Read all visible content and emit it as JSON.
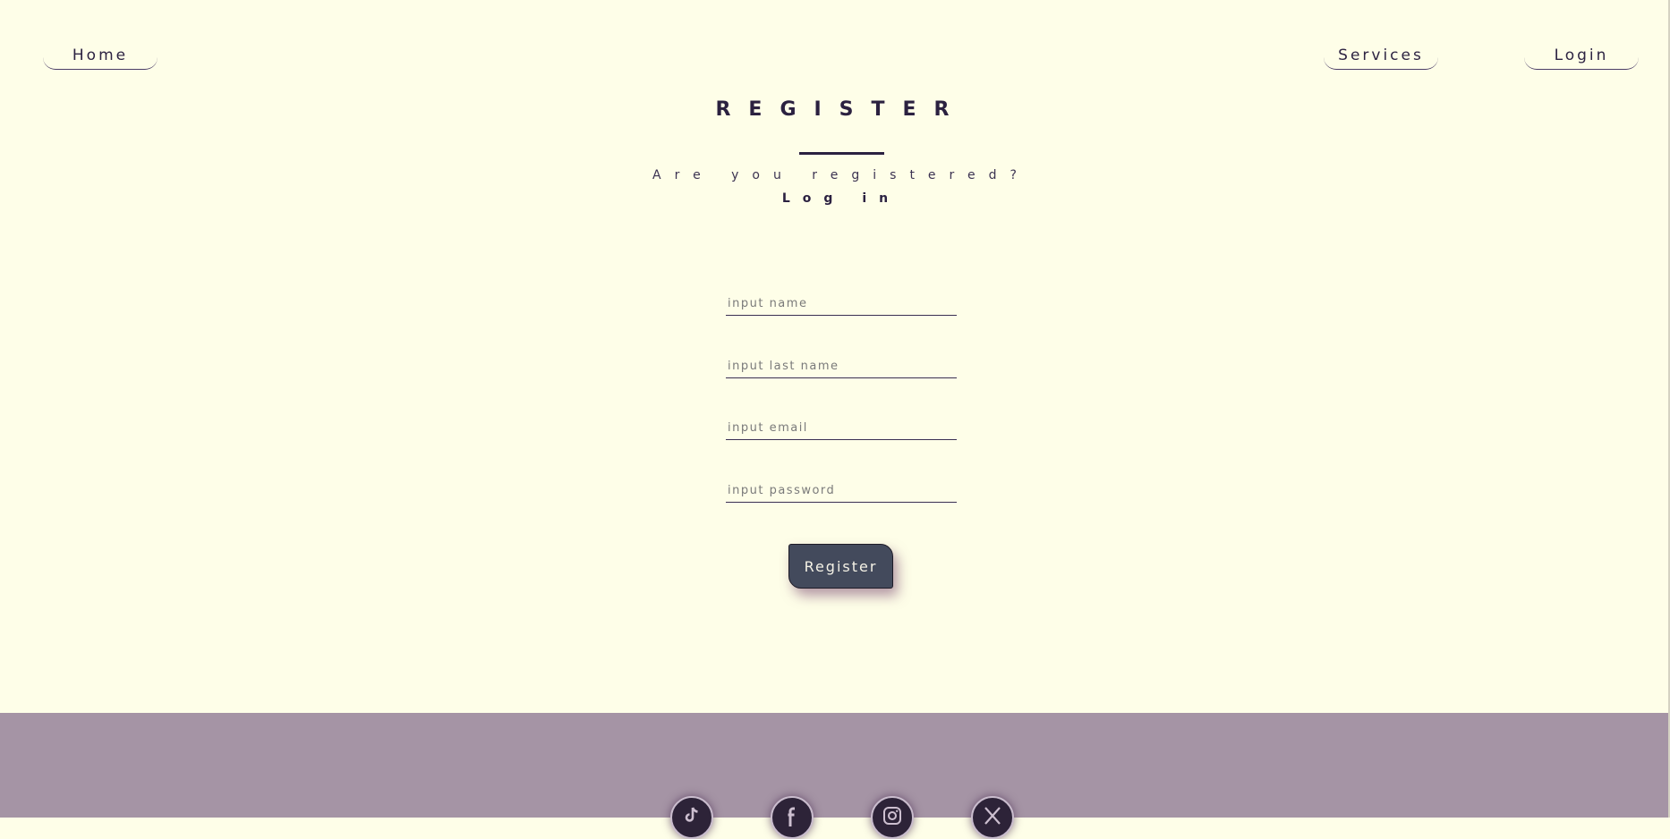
{
  "nav": {
    "home": "Home",
    "services": "Services",
    "login": "Login"
  },
  "page": {
    "title": "REGISTER",
    "subtitle": "Are you registered?",
    "login_link": "Log in"
  },
  "form": {
    "name_placeholder": "input name",
    "last_name_placeholder": "input last name",
    "email_placeholder": "input email",
    "password_placeholder": "input password",
    "submit_label": "Register"
  },
  "footer": {
    "socials": [
      "tiktok-icon",
      "facebook-icon",
      "instagram-icon",
      "x-icon"
    ]
  },
  "colors": {
    "background": "#FEFEE8",
    "footer": "#A594A5",
    "button": "#434A5C",
    "text": "#2B2140"
  }
}
